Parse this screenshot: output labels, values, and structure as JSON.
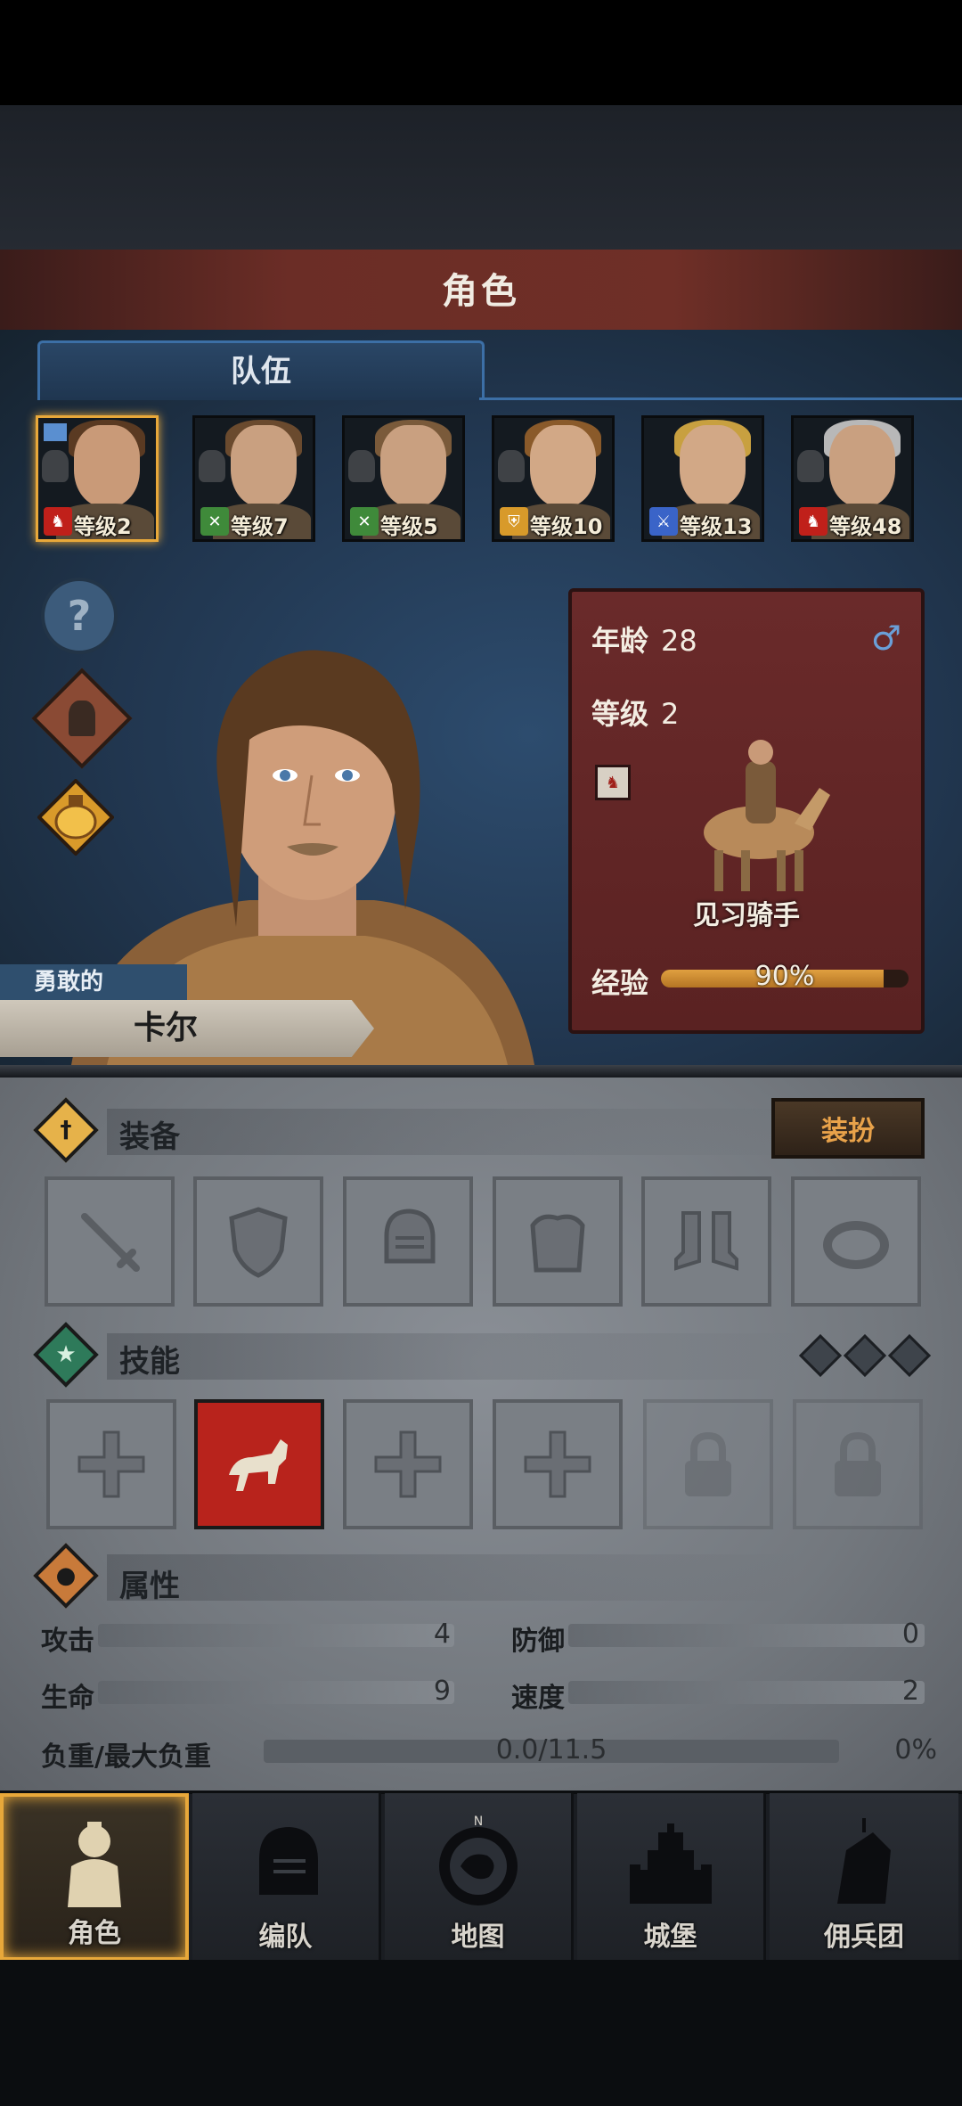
{
  "header": {
    "title": "角色"
  },
  "team": {
    "tab_label": "队伍",
    "members": [
      {
        "level": "等级2",
        "class_icon": "horse-icon",
        "selected": true
      },
      {
        "level": "等级7",
        "class_icon": "bow-icon",
        "selected": false
      },
      {
        "level": "等级5",
        "class_icon": "bow-icon",
        "selected": false
      },
      {
        "level": "等级10",
        "class_icon": "shield-icon",
        "selected": false
      },
      {
        "level": "等级13",
        "class_icon": "sword-icon",
        "selected": false
      },
      {
        "level": "等级48",
        "class_icon": "horse-icon",
        "selected": false
      }
    ]
  },
  "character": {
    "epithet": "勇敢的",
    "name": "卡尔",
    "age_label": "年龄",
    "age": "28",
    "gender_symbol": "♂",
    "level_label": "等级",
    "level": "2",
    "class_name": "见习骑手",
    "exp_label": "经验",
    "exp_percent_text": "90%",
    "exp_fraction": 0.9
  },
  "equipment": {
    "title": "装备",
    "dress_button": "装扮",
    "slots": [
      "sword-icon",
      "shield-icon",
      "helmet-icon",
      "armor-icon",
      "boots-icon",
      "ring-icon"
    ]
  },
  "skills": {
    "title": "技能",
    "slots": [
      "cross-icon",
      "horse-skill-icon",
      "cross-icon",
      "cross-icon",
      "lock-icon",
      "lock-icon"
    ]
  },
  "attributes": {
    "title": "属性",
    "attack_label": "攻击",
    "attack": "4",
    "defense_label": "防御",
    "defense": "0",
    "hp_label": "生命",
    "hp": "9",
    "speed_label": "速度",
    "speed": "2",
    "load_label": "负重/最大负重",
    "load": "0.0/11.5",
    "load_percent": "0%"
  },
  "nav": [
    {
      "label": "角色",
      "icon": "knight-icon",
      "selected": true
    },
    {
      "label": "编队",
      "icon": "helmet-icon",
      "selected": false
    },
    {
      "label": "地图",
      "icon": "compass-icon",
      "selected": false
    },
    {
      "label": "城堡",
      "icon": "castle-icon",
      "selected": false
    },
    {
      "label": "佣兵团",
      "icon": "mercenary-icon",
      "selected": false
    }
  ],
  "colors": {
    "accent": "#e8a83a",
    "exp": "#e0a040",
    "panel_red": "#6a2a2a",
    "panel_blue": "#2d4c6e"
  }
}
